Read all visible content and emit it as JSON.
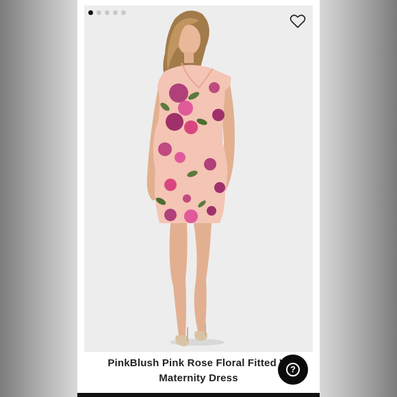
{
  "gallery": {
    "image_count": 5,
    "active_index": 0,
    "favorite_icon": "heart-outline-icon"
  },
  "product": {
    "title_line1": "PinkBlush Pink Rose Floral Fitted W",
    "title_line2": "Maternity Dress"
  },
  "help": {
    "label": "?",
    "icon": "help-circle-icon"
  },
  "colors": {
    "dress_base": "#f4c4b4",
    "flower_primary": "#a0306a",
    "flower_secondary": "#e05a9a",
    "leaf": "#5c7a3c",
    "help_button_bg": "#0b0b0b"
  }
}
